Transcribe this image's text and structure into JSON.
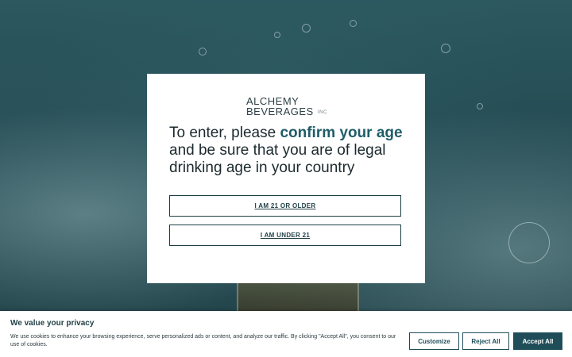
{
  "modal": {
    "logo": {
      "line1": "ALCHEMY",
      "line2": "BEVERAGES",
      "suffix": "INC"
    },
    "headline": {
      "prefix": "To enter, please ",
      "accent": "confirm your age",
      "suffix": " and be sure that you are of legal drinking age in your country"
    },
    "buttons": {
      "over21": "I AM 21 OR OLDER",
      "under21": "I AM UNDER 21"
    }
  },
  "cookie_banner": {
    "title": "We value your privacy",
    "text": "We use cookies to enhance your browsing experience, serve personalized ads or content, and analyze our traffic. By clicking \"Accept All\", you consent to our use of cookies.",
    "customize_label": "Customize",
    "reject_label": "Reject All",
    "accept_label": "Accept All"
  },
  "colors": {
    "accent": "#1f5d68",
    "button_dark": "#1f4e58",
    "background": "#234950"
  }
}
